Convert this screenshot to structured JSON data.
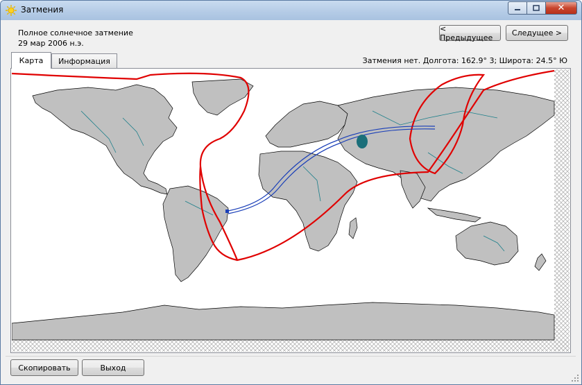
{
  "window": {
    "title": "Затмения",
    "icon": "sun-icon",
    "close_glyph": "✕"
  },
  "eclipse": {
    "type": "Полное солнечное затмение",
    "date": "29 мар 2006 н.э."
  },
  "nav": {
    "prev_label": "< Предыдущее",
    "next_label": "Следущее >"
  },
  "tabs": [
    {
      "label": "Карта",
      "active": true
    },
    {
      "label": "Информация",
      "active": false
    }
  ],
  "status": {
    "text": "Затмения нет. Долгота: 162.9° 3;  Широта: 24.5° Ю"
  },
  "map": {
    "land_color": "#c0c0c0",
    "ocean_color": "#ffffff",
    "river_color": "#1b7f8a",
    "penumbra_color": "#e00000",
    "path_color": "#1a3fb8"
  },
  "footer": {
    "copy_label": "Скопировать",
    "exit_label": "Выход"
  }
}
